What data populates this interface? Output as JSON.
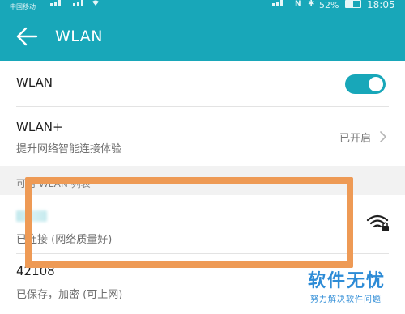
{
  "status_bar": {
    "carrier": "中国移动",
    "battery_percent": "52%",
    "battery_level": 0.52,
    "time": "18:05",
    "icons": [
      "signal-icon",
      "wifi-icon",
      "nfc-icon",
      "bluetooth-icon",
      "battery-icon"
    ]
  },
  "appbar": {
    "title": "WLAN",
    "back_icon": "back-arrow-icon"
  },
  "settings": {
    "wlan": {
      "label": "WLAN",
      "enabled": true
    },
    "wlan_plus": {
      "label": "WLAN+",
      "description": "提升网络智能连接体验",
      "value": "已开启"
    }
  },
  "section": {
    "title": "可用 WLAN 列表"
  },
  "networks": [
    {
      "ssid": "",
      "status": "已连接 (网络质量好)",
      "icon": "wifi-locked-icon"
    },
    {
      "ssid": "42108",
      "status": "已保存，加密 (可上网)"
    }
  ],
  "watermark": {
    "main": "软件无忧",
    "sub": "努力解决软件问题"
  },
  "colors": {
    "accent": "#18a7b9",
    "highlight": "#ee9a55",
    "watermark": "#2c8bd6"
  }
}
